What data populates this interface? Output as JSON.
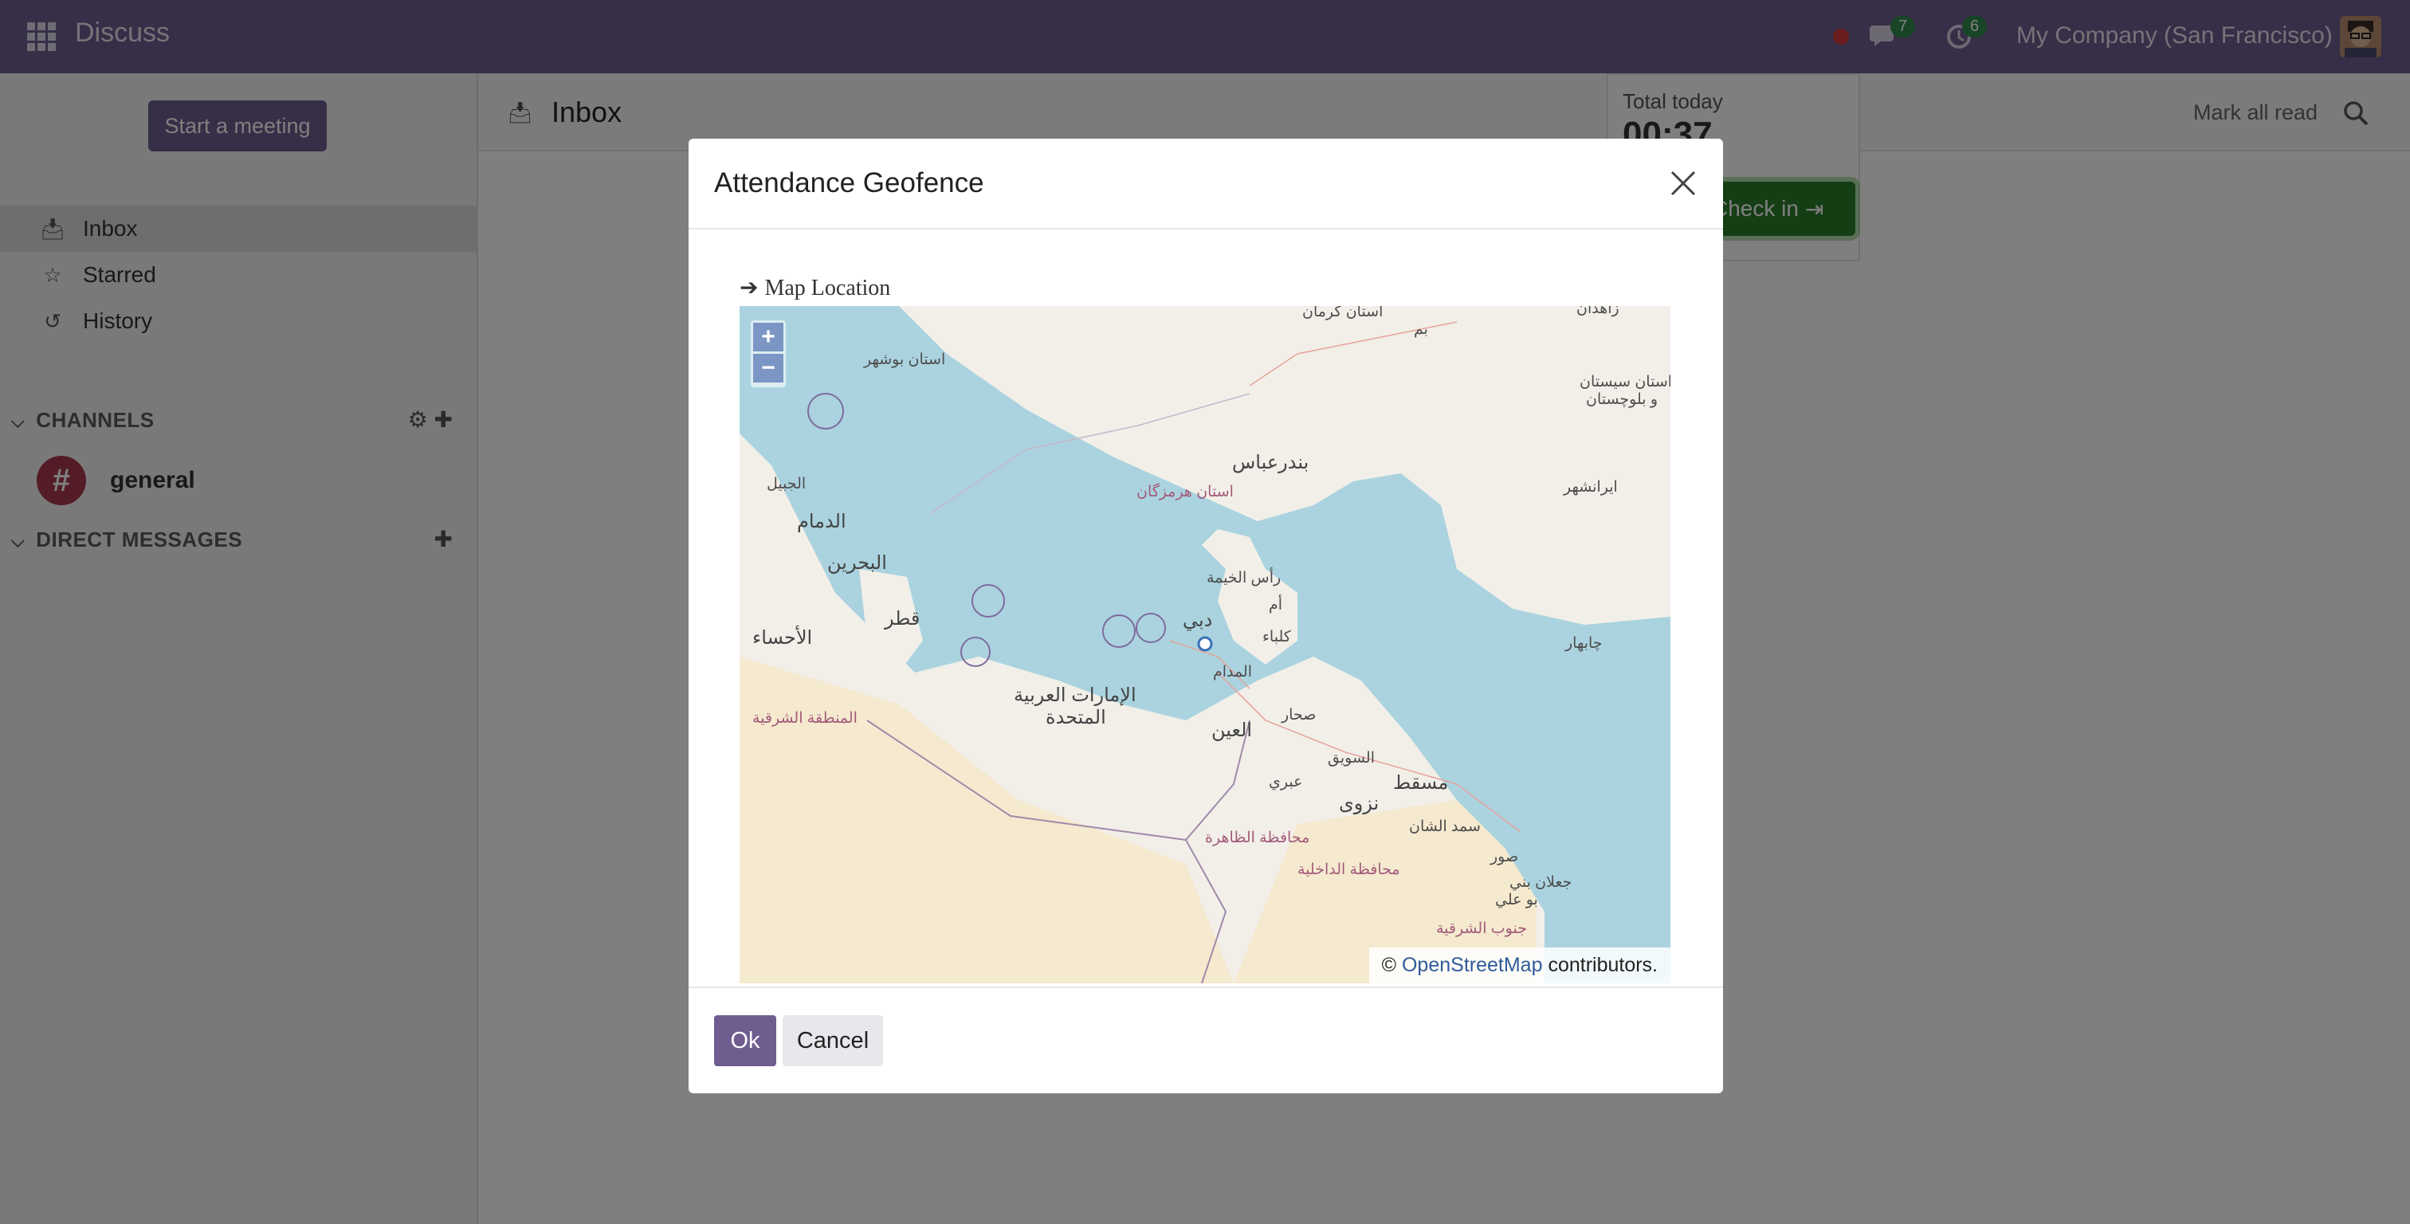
{
  "app": {
    "title": "Discuss"
  },
  "navbar": {
    "chat_count": "7",
    "activity_count": "6",
    "company": "My Company (San Francisco)"
  },
  "sidebar": {
    "start_meeting": "Start a meeting",
    "items": [
      {
        "label": "Inbox",
        "icon": "inbox-icon"
      },
      {
        "label": "Starred",
        "icon": "star-icon"
      },
      {
        "label": "History",
        "icon": "history-icon"
      }
    ],
    "channels_header": "CHANNELS",
    "channels": [
      {
        "label": "general",
        "avatar": "#"
      }
    ],
    "direct_messages_header": "DIRECT MESSAGES"
  },
  "main": {
    "title": "Inbox",
    "mark_all_read": "Mark all read"
  },
  "attendance": {
    "total_today_label": "Total today",
    "total_time": "00:37",
    "check_in_label": "Check in"
  },
  "modal": {
    "title": "Attendance Geofence",
    "map_label": "Map Location",
    "zoom_in": "+",
    "zoom_out": "−",
    "attribution_prefix": "©",
    "attribution_link": "OpenStreetMap",
    "attribution_suffix": "contributors.",
    "ok_label": "Ok",
    "cancel_label": "Cancel"
  },
  "map_places": {
    "kerman": "استان کرمان",
    "bam": "بم",
    "zahedan": "زاهدان",
    "bushehr": "استان بوشهر",
    "sistan": "استان سیستان",
    "baluchestan": "و بلوچستان",
    "bandar_abbas": "بندرعباس",
    "hormozgan": "استان هرمزگان",
    "iranshahr": "ایرانشهر",
    "jubail": "الجبيل",
    "dammam": "الدمام",
    "bahrain": "البحرين",
    "rak": "رأس الخيمة",
    "qatar": "قطر",
    "hofuf": "الأحساء",
    "dubai": "دبي",
    "umm": "أم",
    "kalba": "كلباء",
    "madam": "المدام",
    "chabahar": "چابهار",
    "uae1": "الإمارات العربية",
    "uae2": "المتحدة",
    "eastern": "المنطقة الشرقية",
    "sohar": "صحار",
    "al_ain": "العين",
    "suwaiq": "السويق",
    "muscat": "مسقط",
    "ibri": "عبري",
    "nizwa": "نزوى",
    "dhahirah": "محافظة الظاهرة",
    "samad": "سمد الشان",
    "sur": "صور",
    "jalan1": "جعلان بني",
    "jalan2": "بو علي",
    "dakhiliyah": "محافظة الداخلية",
    "sharqiyah": "جنوب الشرقية"
  }
}
